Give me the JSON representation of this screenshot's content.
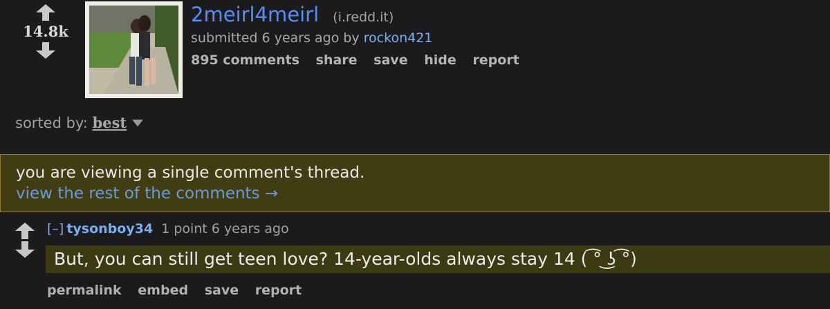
{
  "post": {
    "score": "14.8k",
    "title": "2meirl4meirl",
    "domain": "(i.redd.it)",
    "tagline_prefix": "submitted 6 years ago by ",
    "author": "rockon421",
    "buttons": [
      "895 comments",
      "share",
      "save",
      "hide",
      "report"
    ]
  },
  "sort": {
    "label": "sorted by: ",
    "value": "best"
  },
  "notice": {
    "message": "you are viewing a single comment's thread.",
    "link": "view the rest of the comments →"
  },
  "comment": {
    "collapse": "[–]",
    "author": "tysonboy34",
    "meta": "1 point 6 years ago",
    "body": "But, you can still get teen love? 14-year-olds always stay 14 ( ͡° ͜ʖ ͡°)",
    "buttons": [
      "permalink",
      "embed",
      "save",
      "report"
    ]
  },
  "colors": {
    "background": "#1b1b1d",
    "title_link": "#5b8cf3",
    "author": "#7aaef0",
    "notice_bg": "#413c12",
    "comment_bg": "#3c3a12"
  },
  "icons": [
    "upvote-arrow-icon",
    "downvote-arrow-icon",
    "dropdown-caret-icon"
  ]
}
